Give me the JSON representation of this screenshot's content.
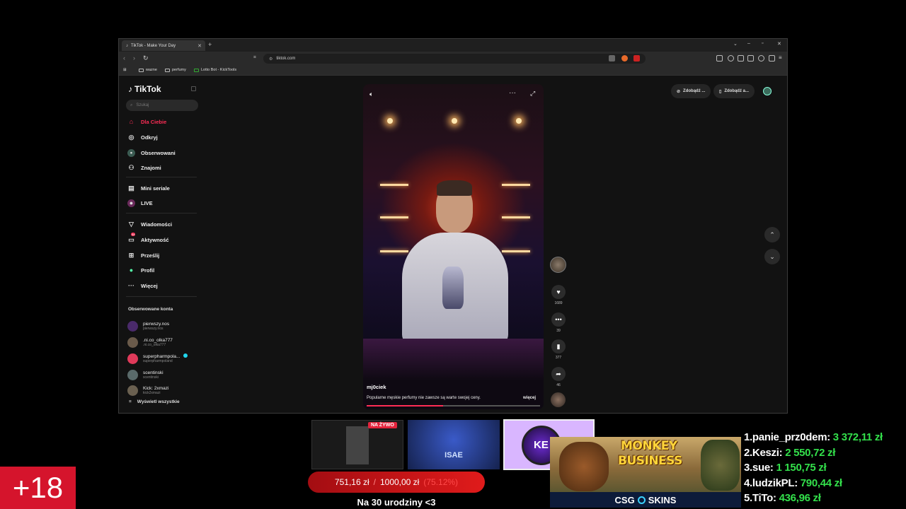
{
  "browser": {
    "tab_title": "TikTok - Make Your Day",
    "url": "tiktok.com",
    "bookmarks": [
      "wazne",
      "perfumy",
      "Lotto Bot - KickTools"
    ]
  },
  "tiktok": {
    "logo": "TikTok",
    "search_placeholder": "Szukaj",
    "nav": [
      {
        "label": "Dla Ciebie",
        "icon": "home-icon",
        "active": true
      },
      {
        "label": "Odkryj",
        "icon": "compass-icon"
      },
      {
        "label": "Obserwowani",
        "icon": "avatar-icon"
      },
      {
        "label": "Znajomi",
        "icon": "friends-icon"
      },
      {
        "label": "Mini seriale",
        "icon": "series-icon"
      },
      {
        "label": "LIVE",
        "icon": "live-icon"
      },
      {
        "label": "Wiadomości",
        "icon": "send-icon"
      },
      {
        "label": "Aktywność",
        "icon": "inbox-icon",
        "badge": "34"
      },
      {
        "label": "Prześlij",
        "icon": "upload-icon"
      },
      {
        "label": "Profil",
        "icon": "profile-icon"
      },
      {
        "label": "Więcej",
        "icon": "more-icon"
      }
    ],
    "followed_title": "Obserwowane konta",
    "followed": [
      {
        "name": "pierwszy.nos",
        "handle": "pierwszy.nos"
      },
      {
        "name": ".ni.co_olka777",
        "handle": ".ni.co_olka777"
      },
      {
        "name": "superpharmpola...",
        "handle": "superpharmpoland"
      },
      {
        "name": "scentinski",
        "handle": "scentinski"
      },
      {
        "name": "Kick: 2xmazi",
        "handle": "kick2xmazi"
      }
    ],
    "show_all": "Wyświetl wszystkie",
    "video": {
      "author": "mj0ciek",
      "caption": "Popularne męskie perfumy nie zawsze są warte swojej ceny.",
      "more": "więcej",
      "progress": 0.44,
      "likes": "1689",
      "comments": "39",
      "saves": "377",
      "shares": "46"
    },
    "top_buttons": [
      "Zdobądź ...",
      "Zdobądź a..."
    ]
  },
  "stream": {
    "live_badge": "NA ŻYWO",
    "thumb2_label": "ISAE",
    "thumb3_label": "KE",
    "goal": {
      "current": "751,16 zł",
      "target": "1000,00 zł",
      "percent": "(75.12%)",
      "caption": "Na 30 urodziny <3"
    },
    "ad": {
      "title_line1": "MONKEY",
      "title_line2": "BUSINESS",
      "footer_left": "CSG",
      "footer_right": "SKINS"
    },
    "leaderboard": [
      {
        "rank": "1.",
        "name": "panie_prz0dem:",
        "amount": "3 372,11 zł"
      },
      {
        "rank": "2.",
        "name": "Keszi:",
        "amount": "2 550,72 zł"
      },
      {
        "rank": "3.",
        "name": "sue:",
        "amount": "1 150,75 zł"
      },
      {
        "rank": "4.",
        "name": "ludzikPL:",
        "amount": "790,44 zł"
      },
      {
        "rank": "5.",
        "name": "TiTo:",
        "amount": "436,96 zł"
      }
    ],
    "age_badge": "+18"
  },
  "colors": {
    "tiktok_accent": "#fe2c55",
    "leaderboard_amount": "#33e04b",
    "age_badge": "#d5142c"
  }
}
